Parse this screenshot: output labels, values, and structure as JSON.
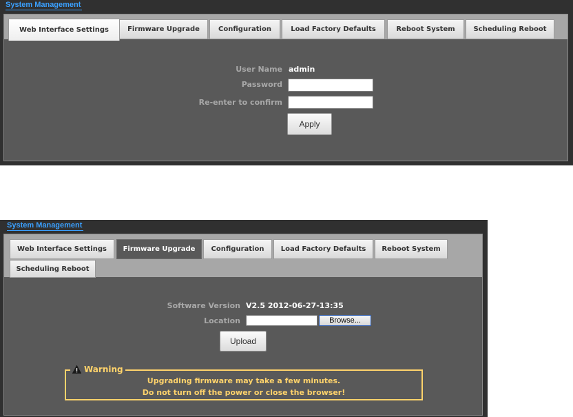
{
  "panel1": {
    "title": "System Management",
    "tabs": [
      {
        "label": "Web Interface Settings",
        "active": true
      },
      {
        "label": "Firmware Upgrade"
      },
      {
        "label": "Configuration"
      },
      {
        "label": "Load Factory Defaults"
      },
      {
        "label": "Reboot System"
      },
      {
        "label": "Scheduling Reboot"
      }
    ],
    "form": {
      "username_label": "User Name",
      "username_value": "admin",
      "password_label": "Password",
      "password_value": "",
      "confirm_label": "Re-enter to confirm",
      "confirm_value": "",
      "apply_label": "Apply"
    }
  },
  "panel2": {
    "title": "System Management",
    "tabs": [
      {
        "label": "Web Interface Settings"
      },
      {
        "label": "Firmware Upgrade",
        "active": true
      },
      {
        "label": "Configuration"
      },
      {
        "label": "Load Factory Defaults"
      },
      {
        "label": "Reboot System"
      },
      {
        "label": "Scheduling Reboot"
      }
    ],
    "form": {
      "version_label": "Software Version",
      "version_value": "V2.5 2012-06-27-13:35",
      "location_label": "Location",
      "location_value": "",
      "browse_label": "Browse...",
      "upload_label": "Upload"
    },
    "warning": {
      "title": "Warning",
      "line1": "Upgrading firmware may take a few minutes.",
      "line2": "Do not turn off the power or close the browser!"
    }
  },
  "colors": {
    "panel_bg": "#303030",
    "content_bg": "#595959",
    "title_blue": "#3aa0ff",
    "warning_yellow": "#ffd36b"
  },
  "icons": {
    "warning": "warning-triangle-icon"
  }
}
